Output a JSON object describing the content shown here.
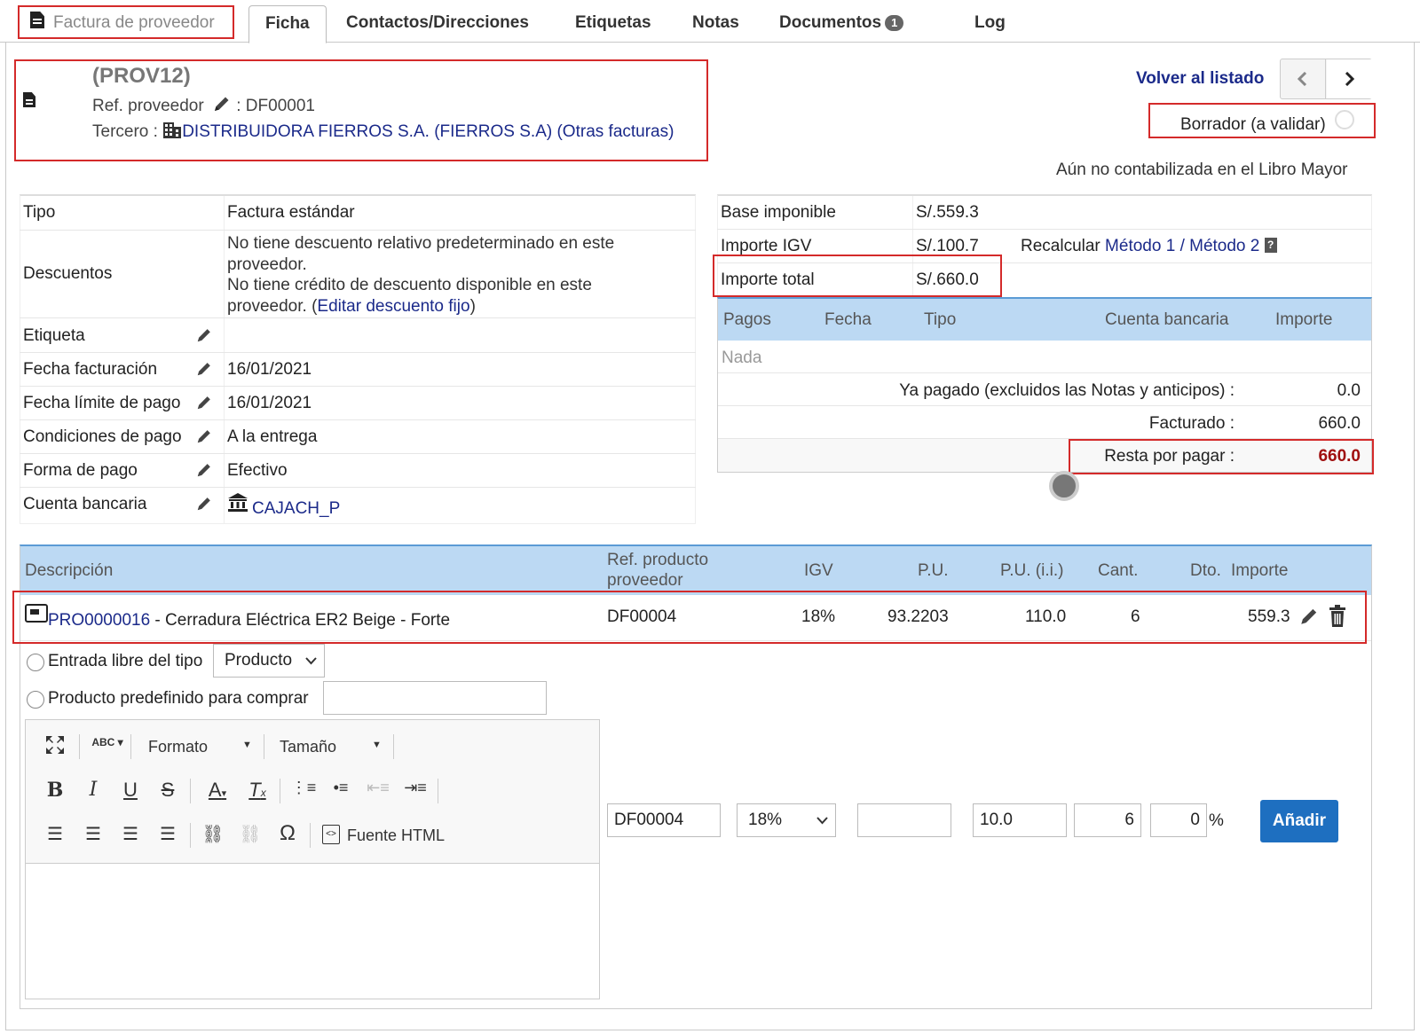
{
  "tabs": {
    "first_label": "Factura de proveedor",
    "ficha": "Ficha",
    "contactos": "Contactos/Direcciones",
    "etiquetas": "Etiquetas",
    "notas": "Notas",
    "documentos": "Documentos",
    "documentos_count": "1",
    "log": "Log"
  },
  "header": {
    "ref": "(PROV12)",
    "ref_proveedor_label": "Ref. proveedor",
    "ref_proveedor_value": ": DF00001",
    "tercero_label": "Tercero :",
    "tercero_link": "DISTRIBUIDORA FIERROS S.A. (FIERROS S.A)",
    "otras_facturas": "(Otras facturas)",
    "volver": "Volver al listado",
    "status": "Borrador (a validar)",
    "contabilizada": "Aún no contabilizada en el Libro Mayor"
  },
  "left_table": {
    "tipo_label": "Tipo",
    "tipo_value": "Factura estándar",
    "descuentos_label": "Descuentos",
    "descuentos_line1": "No tiene descuento relativo predeterminado en este",
    "descuentos_line2": "proveedor.",
    "descuentos_line3": "No tiene crédito de descuento disponible en este",
    "descuentos_line4_prefix": "proveedor. (",
    "descuentos_link": "Editar descuento fijo",
    "descuentos_line4_suffix": ")",
    "etiqueta_label": "Etiqueta",
    "fecha_fact_label": "Fecha facturación",
    "fecha_fact_value": "16/01/2021",
    "fecha_limite_label": "Fecha límite de pago",
    "fecha_limite_value": "16/01/2021",
    "condiciones_label": "Condiciones de pago",
    "condiciones_value": "A la entrega",
    "forma_label": "Forma de pago",
    "forma_value": "Efectivo",
    "cuenta_label": "Cuenta bancaria",
    "cuenta_value": "CAJACH_P"
  },
  "right_table": {
    "base_label": "Base imponible",
    "base_value": "S/.559.3",
    "igv_label": "Importe IGV",
    "igv_value": "S/.100.7",
    "recalcular": "Recalcular",
    "metodo1": "Método 1",
    "slash": "/",
    "metodo2": "Método 2",
    "total_label": "Importe total",
    "total_value": "S/.660.0"
  },
  "payments": {
    "col_pagos": "Pagos",
    "col_fecha": "Fecha",
    "col_tipo": "Tipo",
    "col_cuenta": "Cuenta bancaria",
    "col_importe": "Importe",
    "nada": "Nada",
    "ya_pagado_label": "Ya pagado (excluidos las Notas y anticipos) :",
    "ya_pagado_value": "0.0",
    "facturado_label": "Facturado :",
    "facturado_value": "660.0",
    "resta_label": "Resta por pagar :",
    "resta_value": "660.0",
    "resta_color": "#a01010"
  },
  "lines": {
    "col_descripcion": "Descripción",
    "col_ref_line1": "Ref. producto",
    "col_ref_line2": "proveedor",
    "col_igv": "IGV",
    "col_pu": "P.U.",
    "col_pu_ii": "P.U. (i.i.)",
    "col_cant": "Cant.",
    "col_dto": "Dto.",
    "col_importe": "Importe",
    "row": {
      "product_code": "PRO0000016",
      "product_desc": " - Cerradura Eléctrica ER2 Beige - Forte",
      "ref": "DF00004",
      "igv": "18%",
      "pu": "93.2203",
      "pu_ii": "110.0",
      "cant": "6",
      "importe": "559.3"
    }
  },
  "add_form": {
    "entrada_libre": "Entrada libre del tipo",
    "tipo_select": "Producto",
    "predefinido": "Producto predefinido para comprar",
    "formato": "Formato",
    "tamano": "Tamaño",
    "fuente_html": "Fuente HTML",
    "ref_value": "DF00004",
    "igv_select": "18%",
    "pu_value": "",
    "pu_ii_value": "10.0",
    "cant_value": "6",
    "dto_value": "0",
    "pct": "%",
    "anadir": "Añadir"
  }
}
